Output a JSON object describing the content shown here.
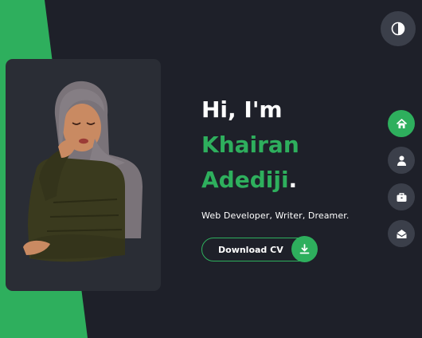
{
  "colors": {
    "accent": "#2eaf5d",
    "background": "#1e2029",
    "card": "#2a2d35",
    "icon_button": "#3b3f4a"
  },
  "hero": {
    "greeting": "Hi, I'm",
    "first_name": "Khairan",
    "last_name": "Adediji",
    "name_dot": ".",
    "tagline": "Web Developer, Writer, Dreamer.",
    "cv_button_label": "Download CV"
  },
  "icons": {
    "theme_toggle": "contrast-icon",
    "cv_button": "download-icon",
    "nav": [
      "home-icon",
      "user-icon",
      "briefcase-icon",
      "envelope-open-icon"
    ]
  },
  "nav": {
    "active_index": 0
  }
}
